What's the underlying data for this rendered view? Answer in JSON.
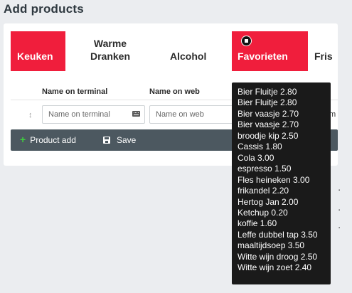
{
  "page": {
    "title": "Add products"
  },
  "tabs": [
    {
      "label": "Keuken"
    },
    {
      "label": "Warme Dranken"
    },
    {
      "label": "Alcohol"
    },
    {
      "label": "Favorieten"
    },
    {
      "label": "Fris"
    }
  ],
  "table": {
    "headers": [
      "Name on terminal",
      "Name on web"
    ],
    "row": {
      "terminal_placeholder": "Name on terminal",
      "web_placeholder": "Name on web",
      "cut_off_text": "m"
    }
  },
  "toolbar": {
    "product_add_label": "Product add",
    "save_label": "Save"
  },
  "tooltip": {
    "items": [
      "Bier Fluitje 2.80",
      "Bier Fluitje 2.80",
      "Bier vaasje 2.70",
      "Bier vaasje 2.70",
      "broodje kip 2.50",
      "Cassis 1.80",
      "Cola 3.00",
      "espresso 1.50",
      "Fles heineken 3.00",
      "frikandel 2.20",
      "Hertog Jan 2.00",
      "Ketchup 0.20",
      "koffie 1.60",
      "Leffe dubbel tap 3.50",
      "maaltijdsoep 3.50",
      "Witte wijn droog 2.50",
      "Witte wijn zoet 2.40"
    ]
  },
  "colors": {
    "active_tab": "#f01e3c",
    "toolbar": "#4c5860",
    "tooltip_bg": "#1a1a1a",
    "add_icon": "#3fcf3f"
  }
}
